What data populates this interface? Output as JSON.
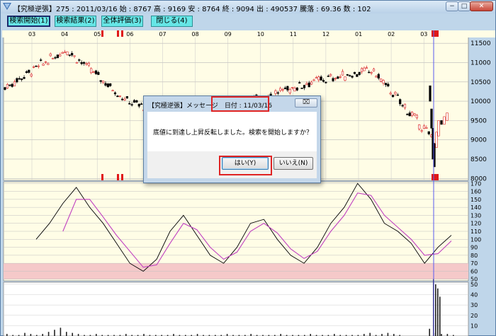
{
  "window": {
    "title": "【究極逆張】275 : 2011/03/16  始 : 8767  高 : 9169  安 : 8764  終 : 9094  出 : 490537  騰落 : 69.36  数 : 102",
    "minimize_glyph": "−",
    "maximize_glyph": "□",
    "close_glyph": "✕"
  },
  "toolbar": {
    "start_label": "検索開始(1)",
    "result_label": "検索結果(2)",
    "eval_label": "全体評価(3)",
    "close_label": "閉じる(4)"
  },
  "dialog": {
    "title": "【究極逆張】メッセージ　日付 : 11/03/16",
    "close_glyph": "⌧",
    "message": "底値に到達し上昇反転しました。検索を開始しますか？",
    "yes_label": "はい(Y)",
    "no_label": "いいえ(N)"
  },
  "colors": {
    "panel_bg": "#fffde6",
    "oversold_band": "#f5c9c9",
    "up_candle": "#d82020",
    "down_candle": "#000000",
    "oscillator_line": "#000000",
    "oscillator_signal": "#c040c0",
    "cursor_line": "#5a5af0",
    "marker": "#e01818",
    "button_bg": "#66e6e6"
  },
  "chart_data": [
    {
      "type": "candlestick",
      "x_tick_labels": [
        "03",
        "04",
        "05",
        "06",
        "07",
        "08",
        "09",
        "10",
        "11",
        "12",
        "01",
        "02",
        "03"
      ],
      "y_ticks": [
        8000,
        8500,
        9000,
        9500,
        10000,
        10500,
        11000,
        11500
      ],
      "ylim": [
        7950,
        11650
      ],
      "cursor_date": "2011/03/16",
      "key_points": [
        {
          "date": "2010/03",
          "close": 10350
        },
        {
          "date": "2010/04",
          "close": 11350
        },
        {
          "date": "2010/05",
          "close": 10000
        },
        {
          "date": "2010/06",
          "close": 9500
        },
        {
          "date": "2010/11",
          "close": 10000
        },
        {
          "date": "2011/01",
          "close": 10500
        },
        {
          "date": "2011/02",
          "close": 10800
        },
        {
          "date": "2011/03",
          "close": 9000
        }
      ]
    },
    {
      "type": "line",
      "y_ticks": [
        50,
        60,
        70,
        80,
        90,
        100,
        110,
        120,
        130,
        140,
        150,
        160,
        170
      ],
      "ylim": [
        48,
        172
      ],
      "oversold_band": [
        50,
        70
      ],
      "series": [
        {
          "values": [
            100,
            120,
            145,
            165,
            140,
            120,
            95,
            70,
            60,
            75,
            110,
            130,
            105,
            80,
            70,
            90,
            120,
            125,
            100,
            80,
            70,
            90,
            120,
            140,
            170,
            150,
            120,
            110,
            95,
            70,
            90,
            105
          ]
        },
        {
          "values": [
            null,
            null,
            110,
            150,
            150,
            128,
            105,
            85,
            65,
            68,
            95,
            120,
            112,
            90,
            75,
            84,
            110,
            120,
            108,
            88,
            76,
            85,
            110,
            130,
            158,
            155,
            130,
            115,
            100,
            80,
            82,
            98
          ]
        }
      ]
    },
    {
      "type": "bar",
      "y_ticks": [
        10,
        20,
        30,
        40,
        50
      ],
      "ylim": [
        0,
        52
      ],
      "values": [
        2,
        1,
        1,
        3,
        2,
        1,
        2,
        4,
        6,
        8,
        4,
        3,
        2,
        1,
        1,
        2,
        1,
        1,
        1,
        1,
        2,
        1,
        1,
        2,
        1,
        1,
        1,
        1,
        2,
        1,
        1,
        1,
        2,
        1,
        1,
        1,
        1,
        2,
        1,
        1,
        1,
        2,
        1,
        1,
        1,
        1,
        2,
        1,
        1,
        1,
        1,
        2,
        1,
        1,
        1,
        2,
        1,
        1,
        1,
        1,
        2,
        3,
        1,
        2,
        3,
        2,
        1,
        55,
        50,
        46,
        38,
        7,
        3,
        2,
        2,
        1
      ]
    }
  ]
}
